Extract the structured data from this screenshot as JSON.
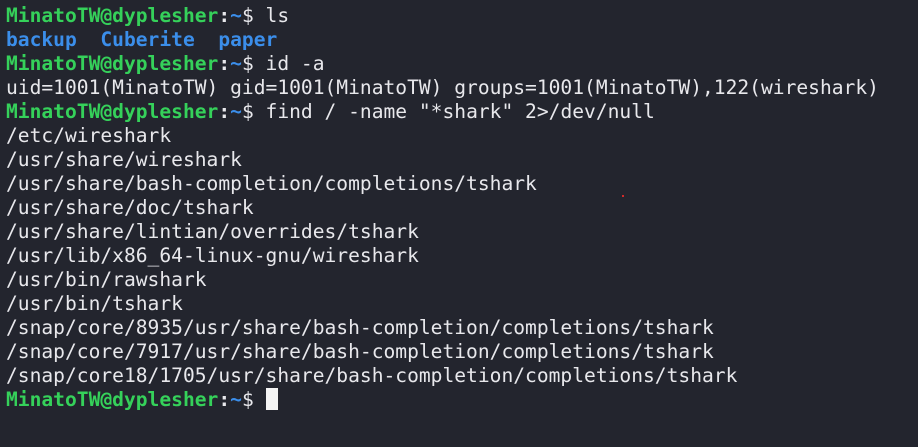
{
  "prompt": {
    "user": "MinatoTW",
    "at": "@",
    "host": "dyplesher",
    "colon": ":",
    "path": "~",
    "symbol": "$"
  },
  "colors": {
    "prompt_user": "#35d15a",
    "prompt_path": "#3b8eea",
    "directory": "#3b8eea",
    "background": "#23252e",
    "text": "#e8e8ec"
  },
  "lines": [
    {
      "type": "prompt",
      "command": "ls"
    },
    {
      "type": "dirs",
      "items": [
        "backup",
        "Cuberite",
        "paper"
      ]
    },
    {
      "type": "prompt",
      "command": "id -a"
    },
    {
      "type": "output",
      "text": "uid=1001(MinatoTW) gid=1001(MinatoTW) groups=1001(MinatoTW),122(wireshark)"
    },
    {
      "type": "prompt",
      "command": "find / -name \"*shark\" 2>/dev/null"
    },
    {
      "type": "output",
      "text": "/etc/wireshark"
    },
    {
      "type": "output",
      "text": "/usr/share/wireshark"
    },
    {
      "type": "output",
      "text": "/usr/share/bash-completion/completions/tshark"
    },
    {
      "type": "output",
      "text": "/usr/share/doc/tshark"
    },
    {
      "type": "output",
      "text": "/usr/share/lintian/overrides/tshark"
    },
    {
      "type": "output",
      "text": "/usr/lib/x86_64-linux-gnu/wireshark"
    },
    {
      "type": "output",
      "text": "/usr/bin/rawshark"
    },
    {
      "type": "output",
      "text": "/usr/bin/tshark"
    },
    {
      "type": "output",
      "text": "/snap/core/8935/usr/share/bash-completion/completions/tshark"
    },
    {
      "type": "output",
      "text": "/snap/core/7917/usr/share/bash-completion/completions/tshark"
    },
    {
      "type": "output",
      "text": "/snap/core18/1705/usr/share/bash-completion/completions/tshark"
    },
    {
      "type": "prompt",
      "command": "",
      "cursor": true
    }
  ]
}
